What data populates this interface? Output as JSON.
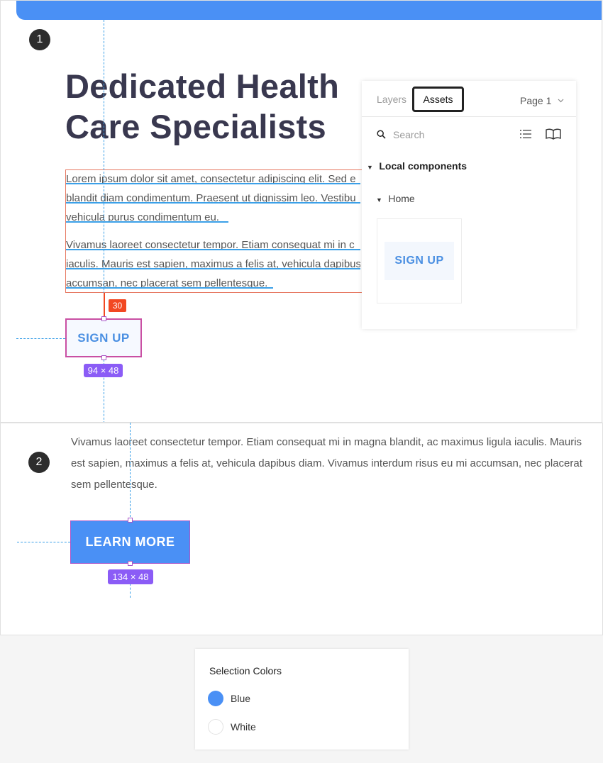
{
  "steps": {
    "one": "1",
    "two": "2"
  },
  "hero": {
    "headline_line1": "Dedicated Health",
    "headline_line2": "Care Specialists",
    "para1_lines": [
      "Lorem ipsum dolor sit amet, consectetur adipiscing elit. Sed e",
      "blandit diam condimentum. Praesent ut dignissim leo. Vestibu",
      "vehicula purus condimentum eu."
    ],
    "para2_lines": [
      "Vivamus laoreet consectetur tempor. Etiam consequat mi in c",
      "iaculis. Mauris est sapien, maximus a felis at, vehicula dapibus",
      "accumsan, nec placerat sem pellentesque."
    ],
    "spacing_badge": "30",
    "signup_label": "SIGN UP",
    "signup_dims": "94 × 48"
  },
  "assets_panel": {
    "tab_layers": "Layers",
    "tab_assets": "Assets",
    "page_select": "Page 1",
    "search_placeholder": "Search",
    "local_components": "Local components",
    "home_group": "Home",
    "component_label": "SIGN UP"
  },
  "section2": {
    "paragraph": "Vivamus laoreet consectetur tempor. Etiam consequat mi in magna blandit, ac maximus ligula iaculis. Mauris est sapien, maximus a felis at, vehicula dapibus diam. Vivamus interdum risus eu mi accumsan, nec placerat sem pellentesque.",
    "learn_label": "LEARN MORE",
    "learn_dims": "134 × 48"
  },
  "selection_colors": {
    "title": "Selection Colors",
    "items": [
      {
        "name": "Blue",
        "color": "#4a90f5"
      },
      {
        "name": "White",
        "color": "#ffffff"
      }
    ]
  },
  "colors": {
    "accent_blue": "#4a90f5",
    "heading": "#39384f",
    "selection_red": "#e77a63",
    "selection_purple": "#a855c7",
    "guide_blue": "#3ba0e8"
  }
}
